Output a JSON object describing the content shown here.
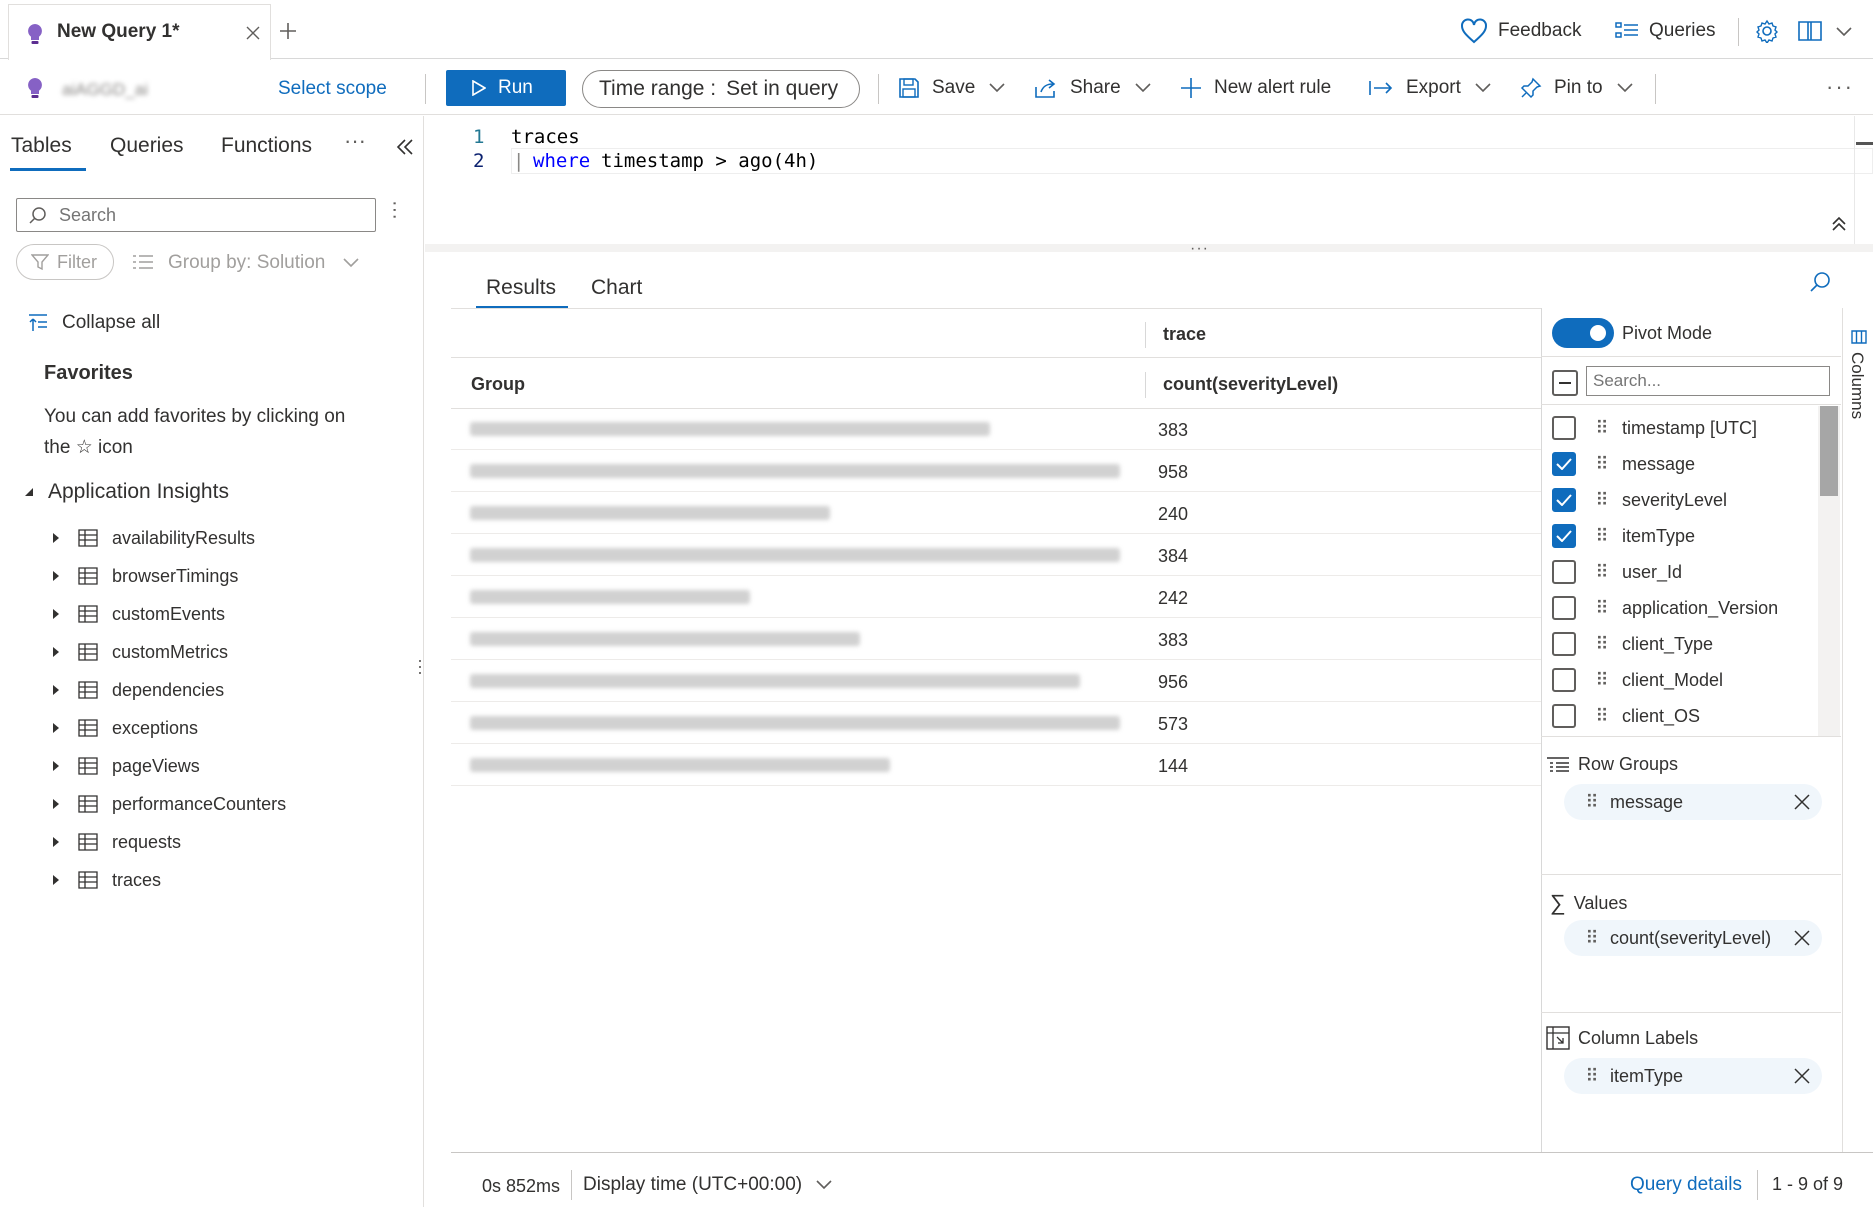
{
  "tab": {
    "title": "New Query 1*"
  },
  "topbar": {
    "feedback": "Feedback",
    "queries": "Queries"
  },
  "toolbar": {
    "scope_name": "aiAGGD_ai",
    "select_scope": "Select scope",
    "run": "Run",
    "time_range_label": "Time range :",
    "time_range_value": "Set in query",
    "save": "Save",
    "share": "Share",
    "new_alert_rule": "New alert rule",
    "export": "Export",
    "pin_to": "Pin to"
  },
  "left": {
    "tabs": [
      "Tables",
      "Queries",
      "Functions"
    ],
    "search_placeholder": "Search",
    "filter": "Filter",
    "group_by": "Group by: Solution",
    "collapse_all": "Collapse all",
    "favorites_title": "Favorites",
    "favorites_text_1": "You can add favorites by clicking on",
    "favorites_text_2": "the ☆ icon",
    "group_title": "Application Insights",
    "tables": [
      "availabilityResults",
      "browserTimings",
      "customEvents",
      "customMetrics",
      "dependencies",
      "exceptions",
      "pageViews",
      "performanceCounters",
      "requests",
      "traces"
    ]
  },
  "editor": {
    "line_numbers": [
      "1",
      "2"
    ],
    "line1": "traces",
    "line2_pipe": "|",
    "line2_kw": "where",
    "line2_rest": "timestamp > ago(4h)"
  },
  "results": {
    "tabs": [
      "Results",
      "Chart"
    ],
    "header_trace": "trace",
    "header_group": "Group",
    "header_count": "count(severityLevel)",
    "counts": [
      "383",
      "958",
      "240",
      "384",
      "242",
      "383",
      "956",
      "573",
      "144"
    ]
  },
  "pivot": {
    "mode_label": "Pivot Mode",
    "search_placeholder": "Search...",
    "columns_tab": "Columns",
    "columns": [
      {
        "name": "timestamp [UTC]",
        "checked": false
      },
      {
        "name": "message",
        "checked": true
      },
      {
        "name": "severityLevel",
        "checked": true
      },
      {
        "name": "itemType",
        "checked": true
      },
      {
        "name": "user_Id",
        "checked": false
      },
      {
        "name": "application_Version",
        "checked": false
      },
      {
        "name": "client_Type",
        "checked": false
      },
      {
        "name": "client_Model",
        "checked": false
      },
      {
        "name": "client_OS",
        "checked": false
      }
    ],
    "row_groups_title": "Row Groups",
    "row_groups_item": "message",
    "values_title": "Values",
    "values_item": "count(severityLevel)",
    "column_labels_title": "Column Labels",
    "column_labels_item": "itemType"
  },
  "status": {
    "elapsed": "0s 852ms",
    "display_time": "Display time (UTC+00:00)",
    "query_details": "Query details",
    "range": "1 - 9 of 9"
  }
}
